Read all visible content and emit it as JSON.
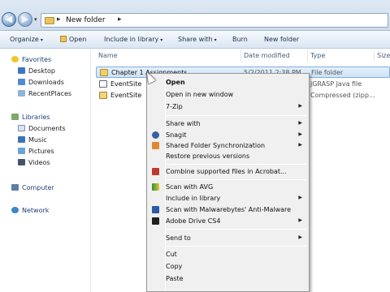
{
  "address": {
    "path": [
      "New folder"
    ],
    "nav_back": "◀",
    "nav_forward": "▶",
    "nav_dropdown": "▾",
    "crumb_sep": "▸"
  },
  "toolbar": {
    "organize": "Organize",
    "open": "Open",
    "include_in_library": "Include in library",
    "share_with": "Share with",
    "burn": "Burn",
    "new_folder": "New folder",
    "dropdown_arrow": "▾"
  },
  "nav": {
    "favorites": "Favorites",
    "favorites_items": [
      "Desktop",
      "Downloads",
      "RecentPlaces"
    ],
    "libraries": "Libraries",
    "libraries_items": [
      "Documents",
      "Music",
      "Pictures",
      "Videos"
    ],
    "computer": "Computer",
    "network": "Network"
  },
  "columns": {
    "name": "Name",
    "date_modified": "Date modified",
    "type": "Type",
    "size": "Size"
  },
  "files": [
    {
      "name": "Chapter 1 Assignments",
      "date": "5/2/2011 2:38 PM",
      "type": "File folder",
      "icon": "folder-icon"
    },
    {
      "name": "EventSite",
      "date": "",
      "type": "jGRASP Java file",
      "icon": "java-file-icon"
    },
    {
      "name": "EventSite",
      "date": "",
      "type": "Compressed (zipp...",
      "icon": "zip-file-icon"
    }
  ],
  "context_menu": {
    "open": "Open",
    "open_new_window": "Open in new window",
    "seven_zip": "7-Zip",
    "share_with": "Share with",
    "snagit": "Snagit",
    "shared_folder_sync": "Shared Folder Synchronization",
    "restore_previous": "Restore previous versions",
    "combine_acrobat": "Combine supported files in Acrobat...",
    "scan_avg": "Scan with AVG",
    "include_in_library": "Include in library",
    "scan_malwarebytes": "Scan with Malwarebytes' Anti-Malware",
    "adobe_drive": "Adobe Drive CS4",
    "send_to": "Send to",
    "cut": "Cut",
    "copy": "Copy",
    "paste": "Paste",
    "submenu_arrow": "▶"
  },
  "colors": {
    "folder": "#f0cf6c",
    "selection": "#cde3f7",
    "selection_border": "#84acdd",
    "nav_group_text": "#1e3f75"
  }
}
